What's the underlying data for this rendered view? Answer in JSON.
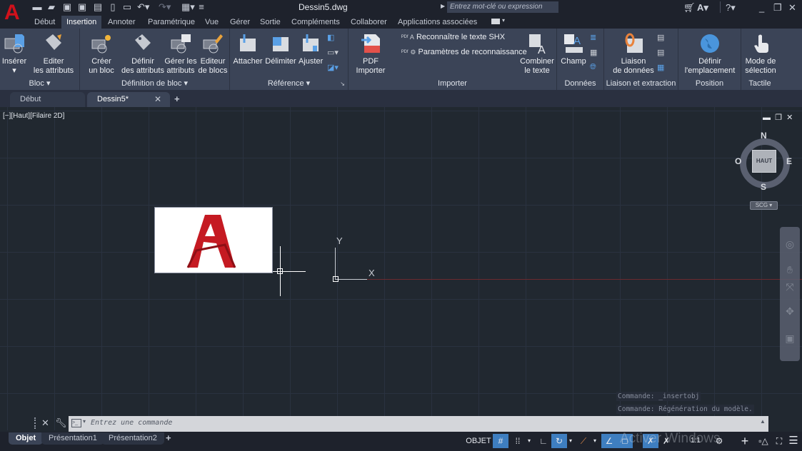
{
  "app": {
    "title": "Dessin5.dwg",
    "logo": "A"
  },
  "search": {
    "placeholder": "Entrez mot-clé ou expression"
  },
  "quick_access": [
    "new-icon",
    "open-icon",
    "save-icon",
    "save-as-icon",
    "plot-icon",
    "share-icon",
    "print-icon",
    "undo-icon",
    "redo-icon",
    "properties-icon",
    "customize-icon"
  ],
  "ribbon_tabs": [
    {
      "label": "Début",
      "active": false
    },
    {
      "label": "Insertion",
      "active": true
    },
    {
      "label": "Annoter",
      "active": false
    },
    {
      "label": "Paramétrique",
      "active": false
    },
    {
      "label": "Vue",
      "active": false
    },
    {
      "label": "Gérer",
      "active": false
    },
    {
      "label": "Sortie",
      "active": false
    },
    {
      "label": "Compléments",
      "active": false
    },
    {
      "label": "Collaborer",
      "active": false
    },
    {
      "label": "Applications associées",
      "active": false
    }
  ],
  "panels": {
    "bloc": {
      "label": "Bloc ▾",
      "inserer": "Insérer",
      "editer1": "Editer",
      "editer2": "les attributs"
    },
    "defbloc": {
      "label": "Définition de bloc ▾",
      "creer1": "Créer",
      "creer2": "un bloc",
      "definir1": "Définir",
      "definir2": "des attributs",
      "gerer1": "Gérer les",
      "gerer2": "attributs",
      "editeur1": "Editeur",
      "editeur2": "de blocs"
    },
    "reference": {
      "label": "Référence ▾",
      "attacher": "Attacher",
      "delimiter": "Délimiter",
      "ajuster": "Ajuster"
    },
    "importer": {
      "label": "Importer",
      "pdf1": "PDF",
      "pdf2": "Importer",
      "shx": "Reconnaître le texte SHX",
      "params": "Paramètres de reconnaissance",
      "combiner1": "Combiner",
      "combiner2": "le texte"
    },
    "donnees": {
      "label": "Données",
      "champ": "Champ"
    },
    "liaison": {
      "label": "Liaison et extraction",
      "liaison1": "Liaison",
      "liaison2": "de données"
    },
    "position": {
      "label": "Position",
      "definir1": "Définir",
      "definir2": "l'emplacement"
    },
    "tactile": {
      "label": "Tactile",
      "mode1": "Mode de",
      "mode2": "sélection"
    }
  },
  "doc_tabs": [
    {
      "label": "Début"
    },
    {
      "label": "Dessin5*",
      "active": true
    }
  ],
  "viewport": {
    "label": "[−][Haut][Filaire 2D]"
  },
  "viewcube": {
    "face": "HAUT",
    "n": "N",
    "s": "S",
    "e": "E",
    "w": "O",
    "ucs": "SCG"
  },
  "ucs_icon": {
    "x": "X",
    "y": "Y"
  },
  "command": {
    "history": [
      "Commande:  _insertobj",
      "Commande: Régénération du modèle."
    ],
    "placeholder": "Entrez une commande"
  },
  "layout_tabs": [
    {
      "label": "Objet",
      "active": true
    },
    {
      "label": "Présentation1"
    },
    {
      "label": "Présentation2"
    }
  ],
  "status": {
    "space": "OBJET",
    "scale": "1:1"
  },
  "watermark": "Activer Windows",
  "colors": {
    "accent": "#3e7ec0",
    "logo": "#d0111b",
    "ribbon": "#3b4457",
    "canvas": "#212830"
  }
}
